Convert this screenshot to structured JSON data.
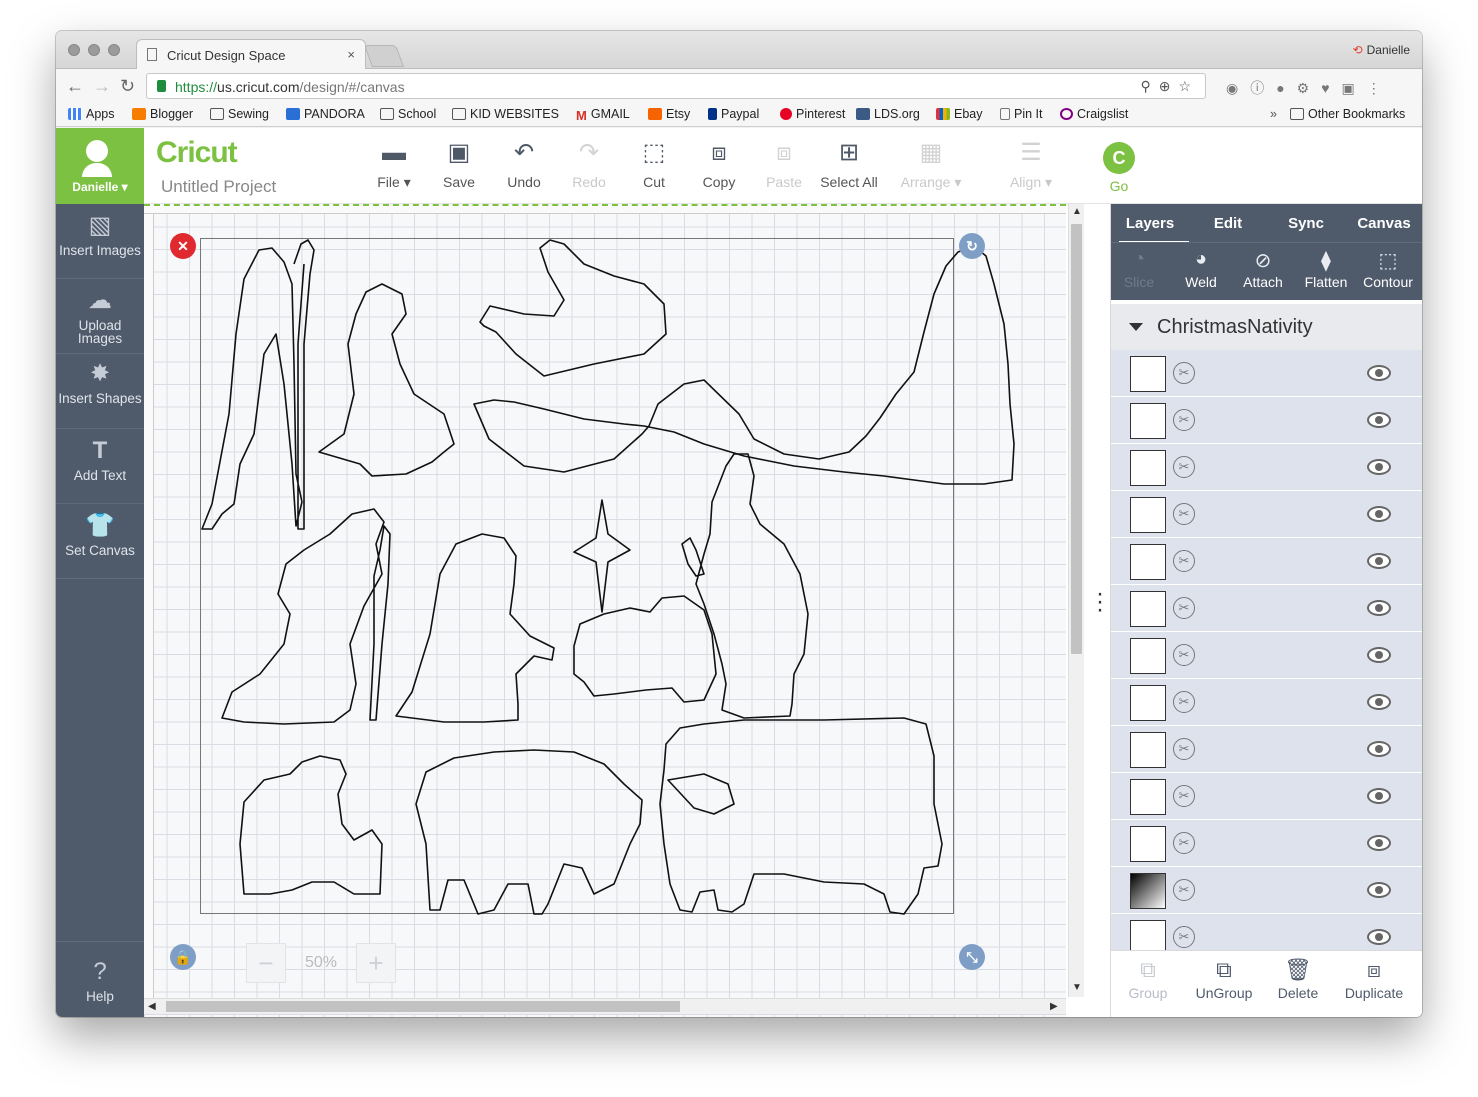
{
  "browser": {
    "tab_title": "Cricut Design Space",
    "tab_close": "×",
    "profile_name": "Danielle",
    "url_scheme": "https://",
    "url_host": "us.cricut.com",
    "url_path": "/design/#/canvas",
    "bookmarks": [
      "Apps",
      "Blogger",
      "Sewing",
      "PANDORA",
      "School",
      "KID WEBSITES",
      "GMAIL",
      "Etsy",
      "Paypal",
      "Pinterest",
      "LDS.org",
      "Ebay",
      "Pin It",
      "Craigslist"
    ],
    "bookmark_overflow": "»",
    "other_bookmarks": "Other Bookmarks"
  },
  "header": {
    "user_name": "Danielle",
    "logo": "Cricut",
    "project_title": "Untitled Project",
    "tools": {
      "file": "File",
      "save": "Save",
      "undo": "Undo",
      "redo": "Redo",
      "cut": "Cut",
      "copy": "Copy",
      "paste": "Paste",
      "select_all": "Select All",
      "arrange": "Arrange",
      "align": "Align"
    },
    "go_label": "Go"
  },
  "leftnav": {
    "insert_images": "Insert Images",
    "upload_images": "Upload Images",
    "insert_shapes": "Insert Shapes",
    "add_text": "Add Text",
    "set_canvas": "Set Canvas",
    "help": "Help"
  },
  "canvas": {
    "zoom_value": "50%",
    "zoom_minus": "−",
    "zoom_plus": "+"
  },
  "panel": {
    "tabs": [
      "Layers",
      "Edit",
      "Sync",
      "Canvas"
    ],
    "tools": [
      "Slice",
      "Weld",
      "Attach",
      "Flatten",
      "Contour"
    ],
    "group_name": "ChristmasNativity",
    "bottom_tools": [
      "Group",
      "UnGroup",
      "Delete",
      "Duplicate"
    ],
    "layer_count": 13
  },
  "colors": {
    "cricut_green": "#7cc142",
    "nav_slate": "#4f5a6b",
    "close_red": "#e0282f",
    "corner_blue": "#7e9ec6"
  }
}
